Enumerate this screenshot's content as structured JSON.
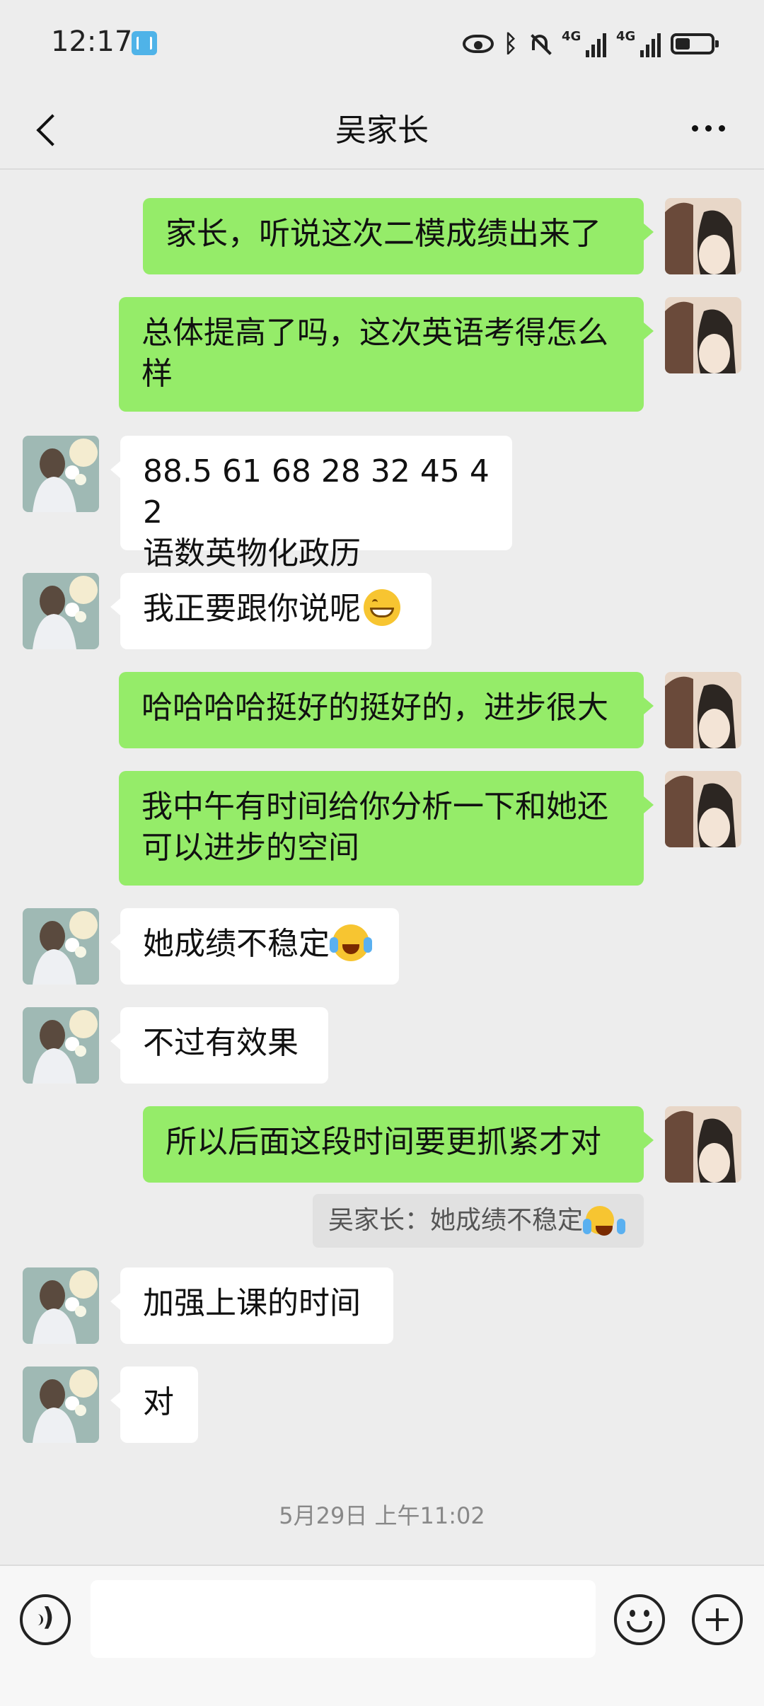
{
  "status_bar": {
    "time": "12:17",
    "icons": [
      "book-app-icon",
      "eye-icon",
      "bluetooth-icon",
      "mute-bell-icon",
      "signal-4g-icon",
      "signal-4g-icon",
      "battery-icon"
    ]
  },
  "header": {
    "title": "吴家长",
    "back_icon": "chevron-left-icon",
    "more_icon": "more-dots-icon"
  },
  "messages": [
    {
      "side": "out",
      "text": "家长，听说这次二模成绩出来了"
    },
    {
      "side": "out",
      "text": "总体提高了吗，这次英语考得怎么\n样"
    },
    {
      "side": "in",
      "text": "88.5 61 68 28 32 45 42\n语数英物化政历"
    },
    {
      "side": "in",
      "text": "我正要跟你说呢",
      "emoji": "grin-emoji"
    },
    {
      "side": "out",
      "text": "哈哈哈哈挺好的挺好的，进步很大"
    },
    {
      "side": "out",
      "text": "我中午有时间给你分析一下和她还\n可以进步的空间"
    },
    {
      "side": "in",
      "text": "她成绩不稳定",
      "emoji": "cry-laugh-emoji"
    },
    {
      "side": "in",
      "text": "不过有效果"
    },
    {
      "side": "out",
      "text": "所以后面这段时间要更抓紧才对",
      "quote": "吴家长：她成绩不稳定"
    },
    {
      "side": "in",
      "text": "加强上课的时间"
    },
    {
      "side": "in",
      "text": "对"
    }
  ],
  "timestamp": "5月29日 上午11:02",
  "input_bar": {
    "voice_icon": "voice-icon",
    "input_value": "",
    "emoji_icon": "smile-icon",
    "plus_icon": "plus-icon"
  }
}
